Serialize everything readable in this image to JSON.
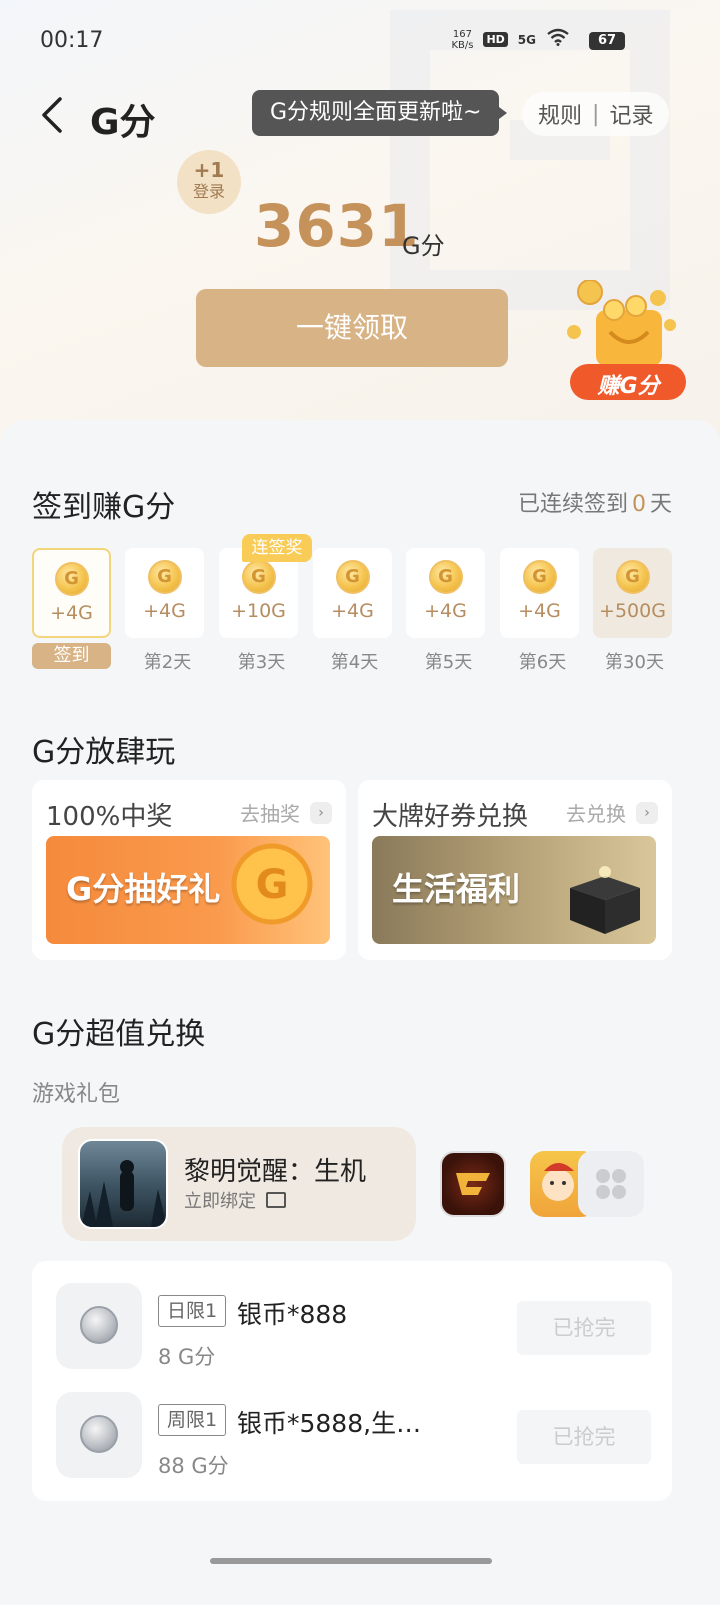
{
  "status_bar": {
    "time": "00:17",
    "speed_value": "167",
    "speed_unit": "KB/s",
    "hd": "HD",
    "network": "5G",
    "battery": "67"
  },
  "header": {
    "title": "G分",
    "tooltip": "G分规则全面更新啦~",
    "rules_link": "规则",
    "separator": "|",
    "records_link": "记录"
  },
  "points": {
    "login_bonus": "+1",
    "login_label": "登录",
    "value": "3631",
    "unit": "G分",
    "claim_button": "一键领取",
    "earn_badge": "赚G分"
  },
  "checkin": {
    "title": "签到赚G分",
    "status_prefix": "已连续签到",
    "streak_days": "0",
    "status_suffix": "天",
    "streak_tag": "连签奖",
    "days": [
      {
        "reward": "+4G",
        "label": "签到"
      },
      {
        "reward": "+4G",
        "label": "第2天"
      },
      {
        "reward": "+10G",
        "label": "第3天"
      },
      {
        "reward": "+4G",
        "label": "第4天"
      },
      {
        "reward": "+4G",
        "label": "第5天"
      },
      {
        "reward": "+4G",
        "label": "第6天"
      },
      {
        "reward": "+500G",
        "label": "第30天"
      }
    ]
  },
  "play": {
    "title": "G分放肆玩",
    "cards": [
      {
        "title": "100%中奖",
        "link": "去抽奖",
        "banner": "G分抽好礼"
      },
      {
        "title": "大牌好券兑换",
        "link": "去兑换",
        "banner": "生活福利"
      }
    ]
  },
  "exchange": {
    "title": "G分超值兑换",
    "subtitle": "游戏礼包",
    "game": {
      "name": "黎明觉醒：生机",
      "bind": "立即绑定"
    },
    "items": [
      {
        "limit": "日限1",
        "name": "银币*888",
        "price": "8 G分",
        "button": "已抢完"
      },
      {
        "limit": "周限1",
        "name": "银币*5888,生…",
        "price": "88 G分",
        "button": "已抢完"
      }
    ]
  },
  "colors": {
    "accent_gold": "#d8b386",
    "points_text": "#c4925a",
    "tag_yellow": "#f8cc57"
  }
}
